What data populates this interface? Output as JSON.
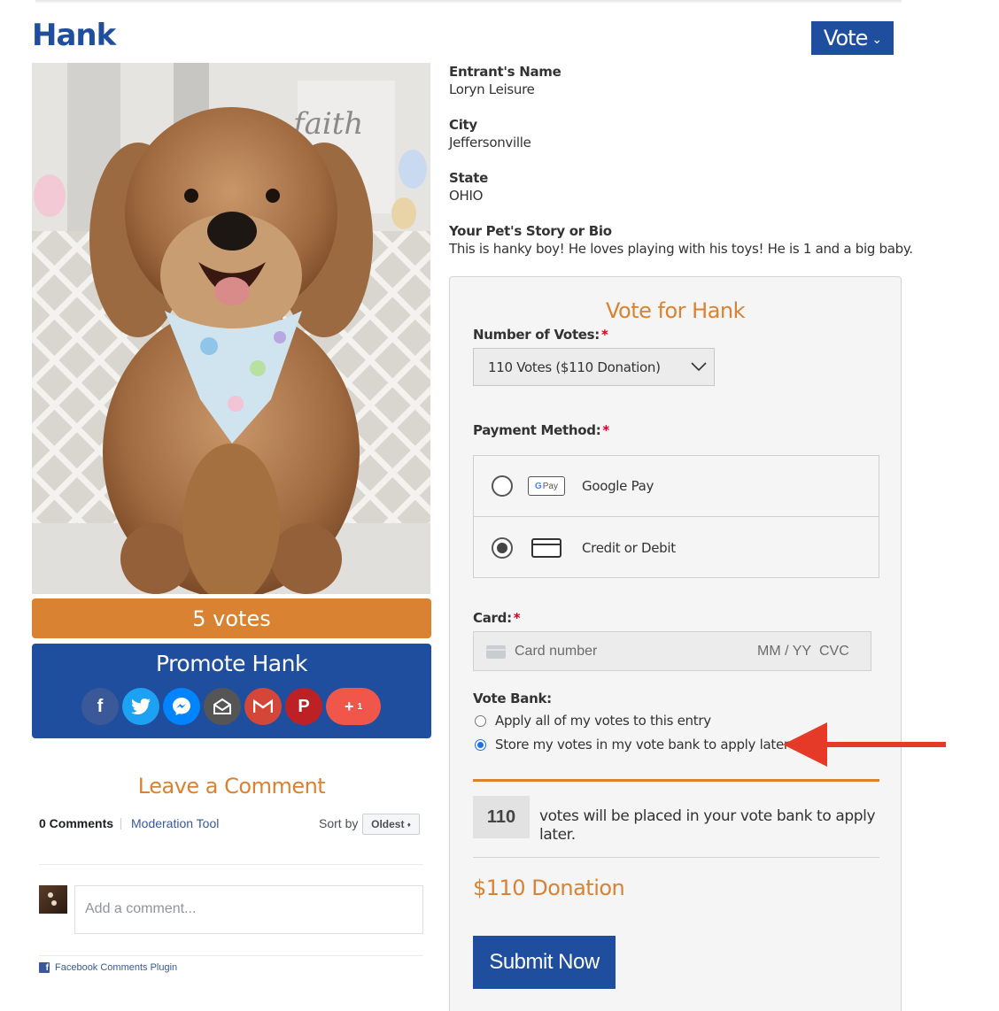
{
  "header": {
    "title": "Hank",
    "vote_button": "Vote"
  },
  "entry": {
    "photo_alt": "dog",
    "votes_label": "5 votes",
    "promote_title": "Promote Hank",
    "share_count": "1"
  },
  "details": [
    {
      "label": "Entrant's Name",
      "value": "Loryn Leisure"
    },
    {
      "label": "City",
      "value": "Jeffersonville"
    },
    {
      "label": "State",
      "value": "OHIO"
    },
    {
      "label": "Your Pet's Story or Bio",
      "value": "This is hanky boy! He loves playing with his toys! He is 1 and a big baby."
    }
  ],
  "vote_form": {
    "title": "Vote for Hank",
    "number_label": "Number of Votes:",
    "number_selected": "110 Votes ($110 Donation)",
    "payment_label": "Payment Method:",
    "payment_options": [
      "Google Pay",
      "Credit or Debit"
    ],
    "gpay_badge": "Pay",
    "card_label": "Card:",
    "card_placeholder": "Card number",
    "card_exp_placeholder": "MM / YY",
    "card_cvc_placeholder": "CVC",
    "vote_bank_label": "Vote Bank:",
    "vote_bank_options": [
      "Apply all of my votes to this entry",
      "Store my votes in my vote bank to apply later"
    ],
    "vote_count": "110",
    "vote_message": "votes will be placed in your vote bank to apply later.",
    "donation": "$110 Donation",
    "submit": "Submit Now"
  },
  "comments": {
    "title": "Leave a Comment",
    "count": "0 Comments",
    "moderation": "Moderation Tool",
    "sort_label": "Sort by",
    "sort_value": "Oldest",
    "placeholder": "Add a comment...",
    "plugin_label": "Facebook Comments Plugin"
  },
  "colors": {
    "brand_blue": "#1f4e9e",
    "accent_orange": "#d98232",
    "arrow_red": "#e53a27"
  }
}
